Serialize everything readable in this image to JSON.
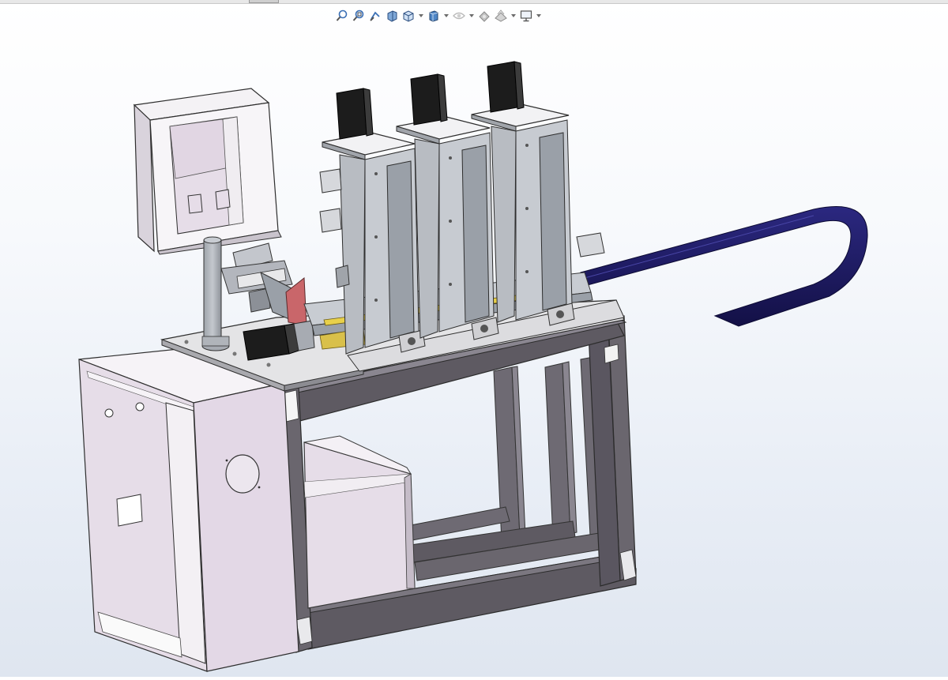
{
  "window": {
    "tab_stub": ""
  },
  "heads_up_toolbar": {
    "tools": [
      {
        "name": "zoom-to-fit-icon"
      },
      {
        "name": "zoom-to-area-icon"
      },
      {
        "name": "previous-view-icon"
      },
      {
        "name": "section-view-icon"
      },
      {
        "name": "view-orientation-icon",
        "dropdown": true
      },
      {
        "name": "display-style-icon",
        "dropdown": true
      },
      {
        "name": "hide-show-items-icon",
        "dropdown": true
      },
      {
        "name": "edit-appearance-icon"
      },
      {
        "name": "apply-scene-icon",
        "dropdown": true
      },
      {
        "name": "view-settings-icon",
        "dropdown": true
      }
    ]
  },
  "model": {
    "colors": {
      "frame": "#5e5a62",
      "panel": "#e6dde8",
      "steel": "#b8bcc2",
      "motor": "#1c1c1c",
      "cable_chain": "#1d1a5c",
      "accent_red": "#c9666a",
      "accent_yellow": "#e8d04a"
    }
  }
}
